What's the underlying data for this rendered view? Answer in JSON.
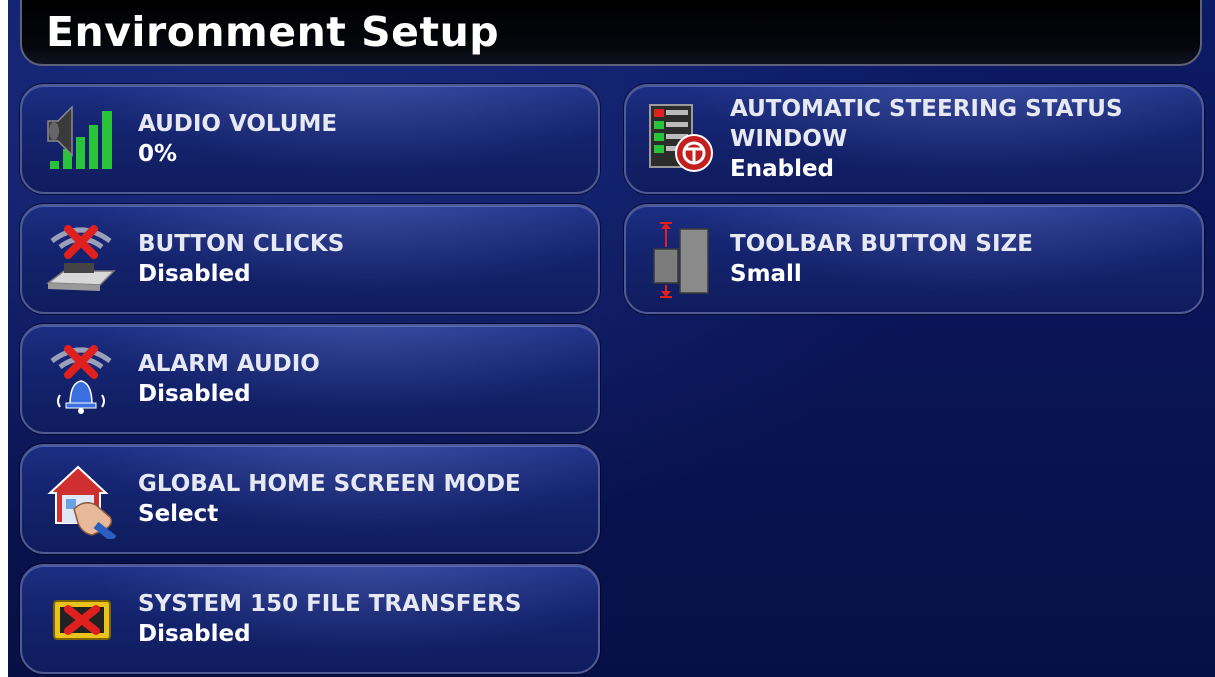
{
  "header": {
    "title": "Environment Setup"
  },
  "tiles": {
    "audio_volume": {
      "label": "AUDIO VOLUME",
      "value": "0%",
      "icon": "speaker-volume-icon"
    },
    "button_clicks": {
      "label": "BUTTON CLICKS",
      "value": "Disabled",
      "icon": "button-click-muted-icon"
    },
    "alarm_audio": {
      "label": "ALARM AUDIO",
      "value": "Disabled",
      "icon": "alarm-bell-muted-icon"
    },
    "global_home": {
      "label": "GLOBAL HOME SCREEN MODE",
      "value": "Select",
      "icon": "home-hand-icon"
    },
    "system150": {
      "label": "SYSTEM 150 FILE TRANSFERS",
      "value": "Disabled",
      "icon": "file-transfer-disabled-icon"
    },
    "auto_steering": {
      "label_line1": "AUTOMATIC STEERING STATUS",
      "label_line2": "WINDOW",
      "value": "Enabled",
      "icon": "steering-status-icon"
    },
    "toolbar_size": {
      "label": "TOOLBAR BUTTON SIZE",
      "value": "Small",
      "icon": "toolbar-size-icon"
    }
  },
  "colors": {
    "background": "#0a1558",
    "tile": "#17276f",
    "tile_border": "#4d5a93",
    "text": "#ffffff",
    "signal_green": "#29c43a",
    "alert_red": "#e0201f"
  }
}
